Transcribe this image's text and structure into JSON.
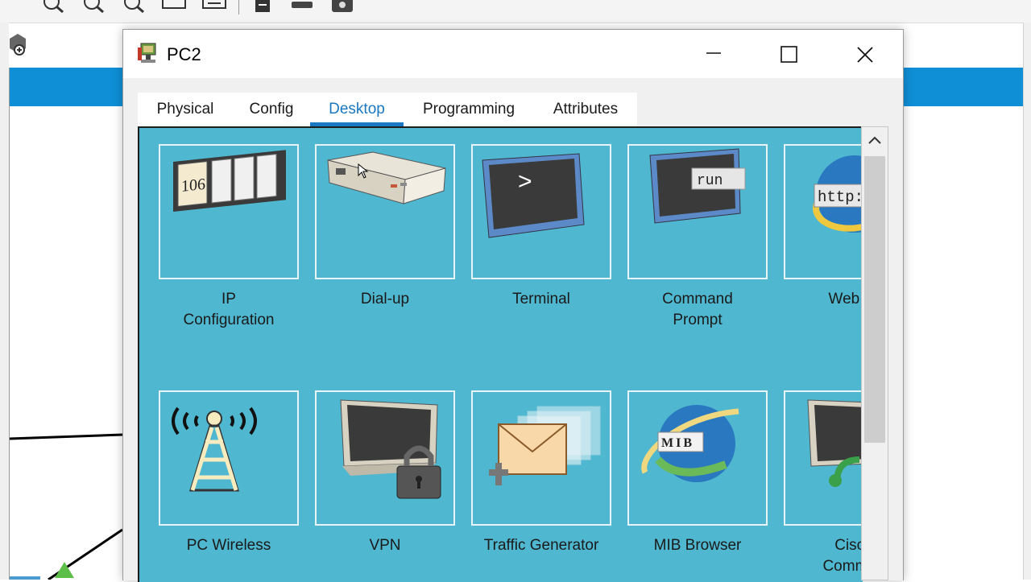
{
  "window": {
    "title": "PC2"
  },
  "tabs": [
    {
      "label": "Physical"
    },
    {
      "label": "Config"
    },
    {
      "label": "Desktop"
    },
    {
      "label": "Programming"
    },
    {
      "label": "Attributes"
    }
  ],
  "active_tab": "Desktop",
  "apps": [
    {
      "label": "IP\nConfiguration",
      "icon_text": "106",
      "icon": "ip-configuration-icon"
    },
    {
      "label": "Dial-up",
      "icon": "modem-icon"
    },
    {
      "label": "Terminal",
      "icon_text": ">",
      "icon": "terminal-icon"
    },
    {
      "label": "Command\nPrompt",
      "icon_text": "run",
      "icon": "command-prompt-icon"
    },
    {
      "label": "Web Br",
      "icon_text": "http:",
      "icon": "web-browser-icon"
    },
    {
      "label": "PC Wireless",
      "icon": "wireless-tower-icon"
    },
    {
      "label": "VPN",
      "icon": "vpn-lock-icon"
    },
    {
      "label": "Traffic Generator",
      "icon": "traffic-generator-icon"
    },
    {
      "label": "MIB Browser",
      "icon_text": "MIB",
      "icon": "mib-browser-icon"
    },
    {
      "label": "Cisco\nCommun",
      "icon": "cisco-communicator-icon"
    }
  ],
  "colors": {
    "desktop_bg": "#4fb7cf",
    "active_tab": "#1a78c2",
    "app_bar_blue": "#0e8fd6"
  }
}
